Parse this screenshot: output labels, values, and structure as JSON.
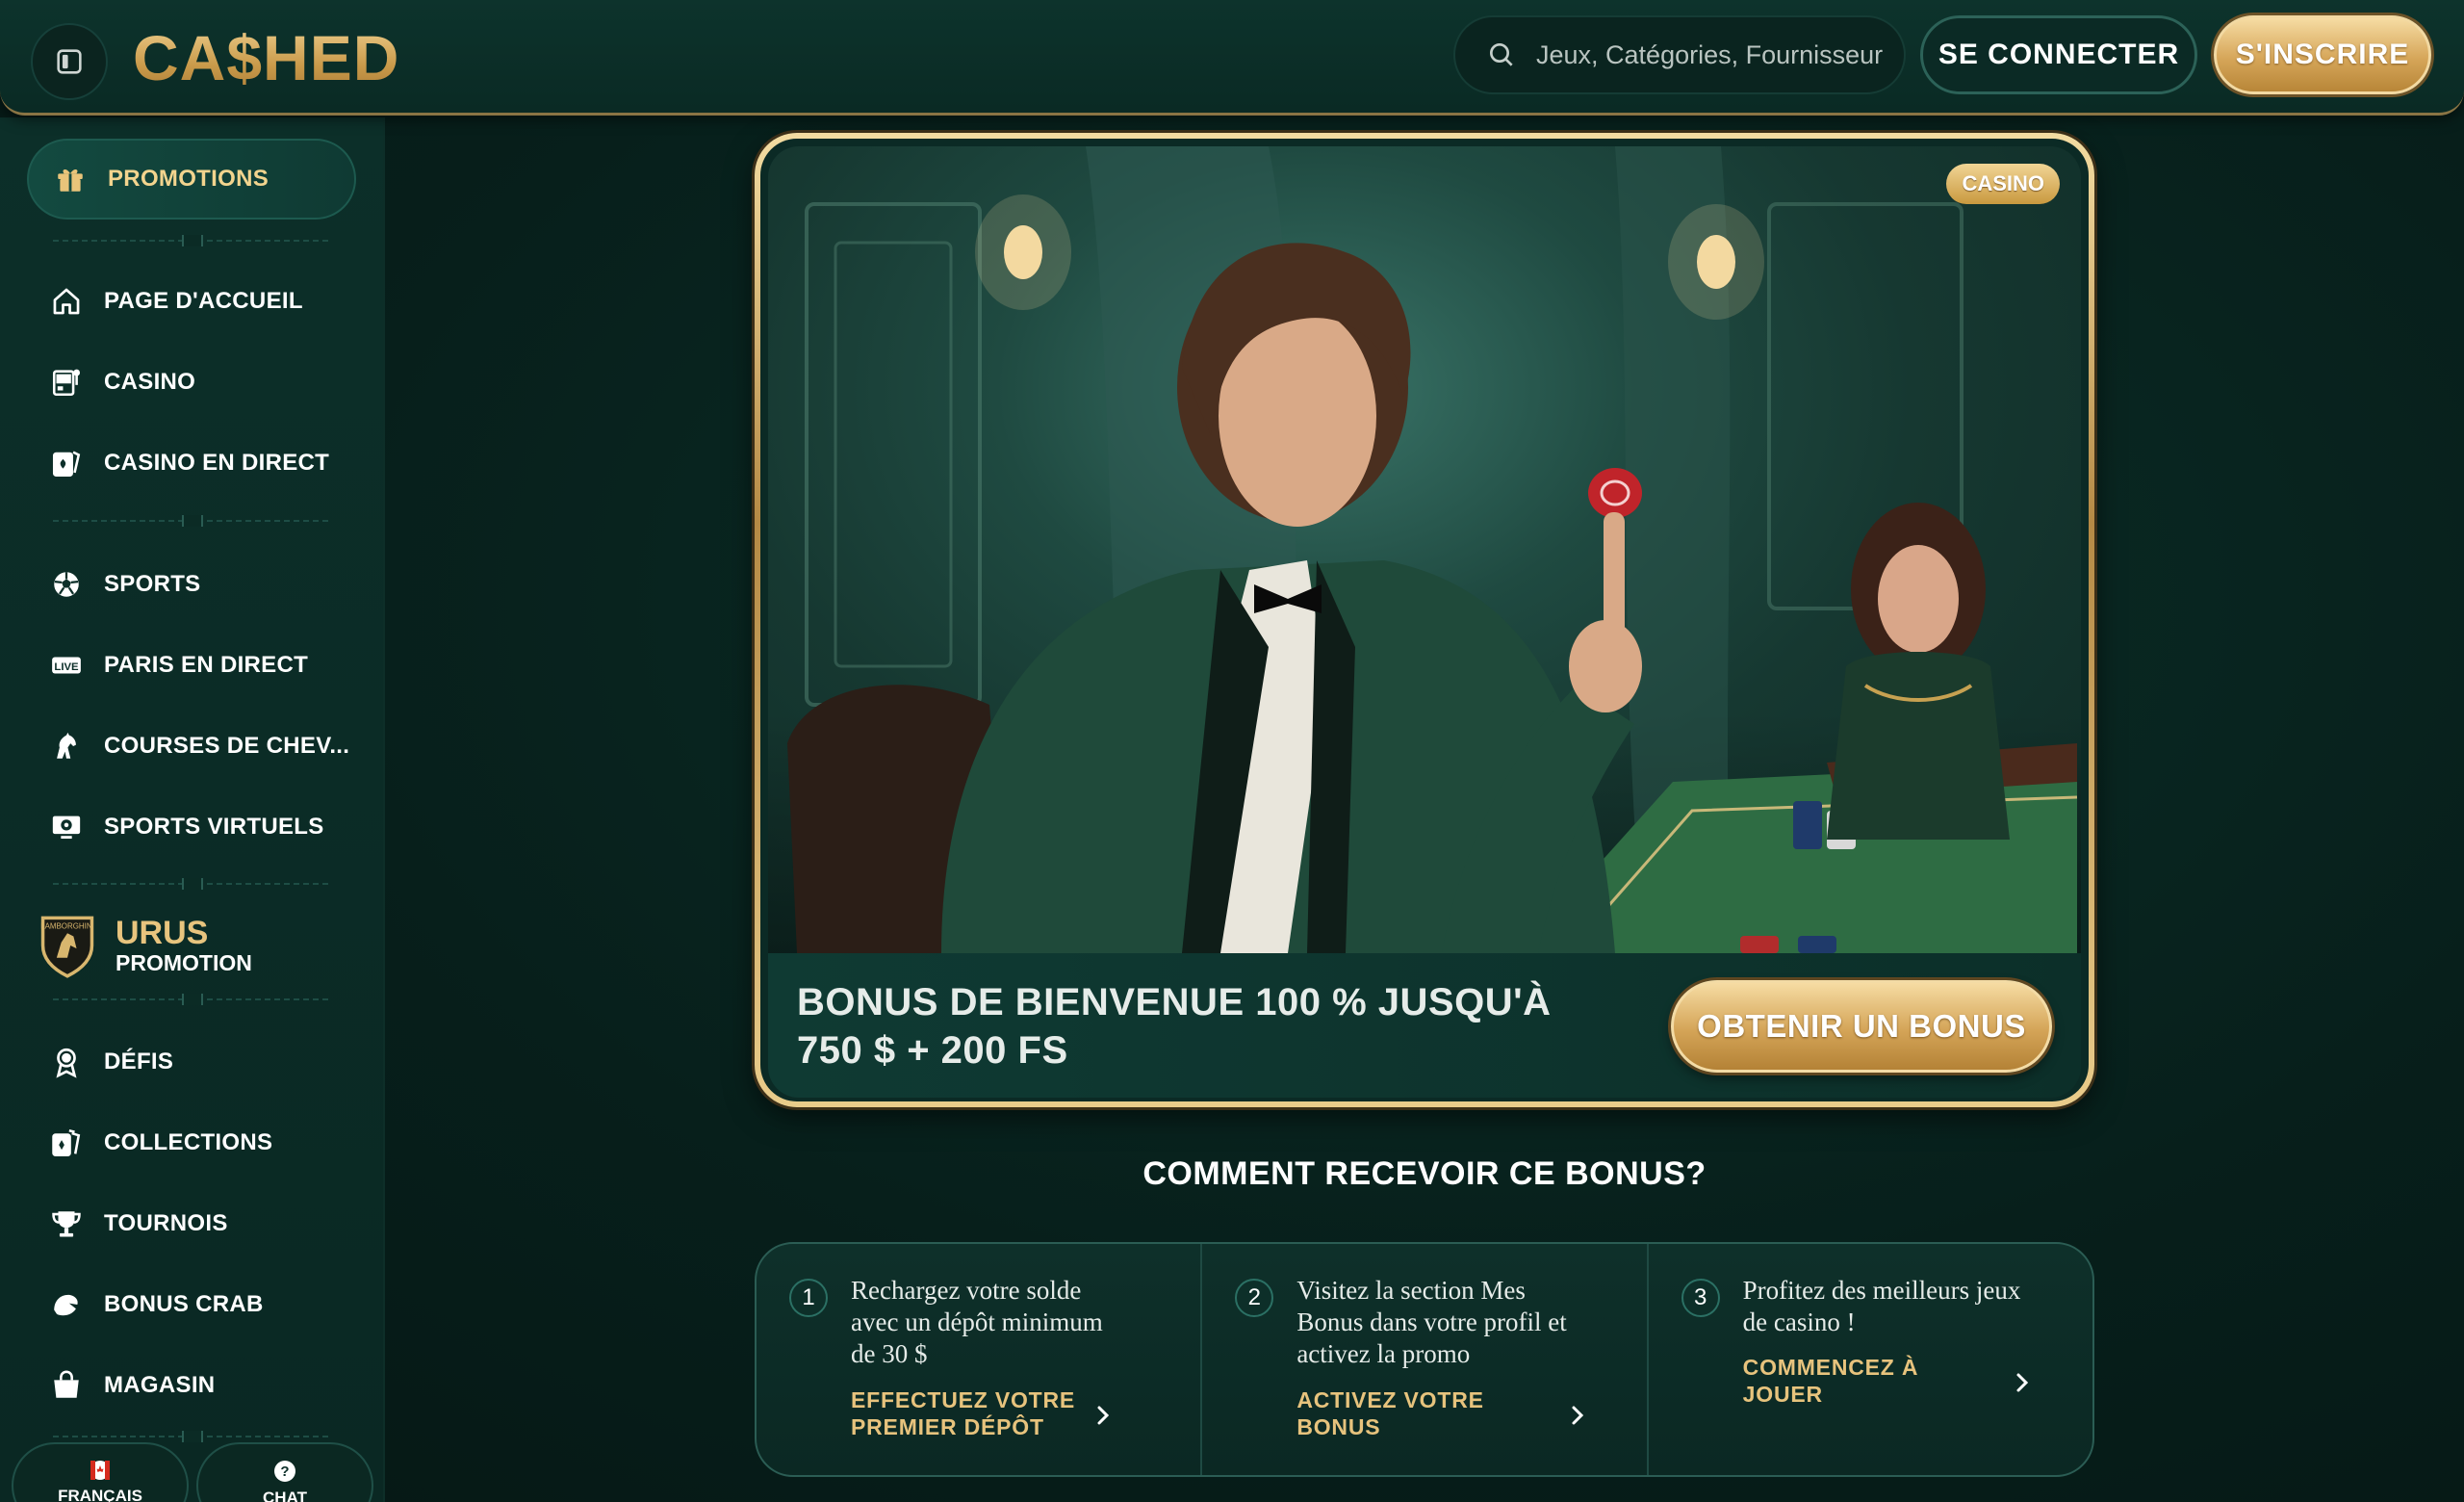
{
  "header": {
    "logo_text": "CA$HED",
    "search_placeholder": "Jeux, Catégories, Fournisseurs",
    "login_label": "SE CONNECTER",
    "register_label": "S'INSCRIRE"
  },
  "sidebar": {
    "promotions_label": "PROMOTIONS",
    "items_group1": [
      {
        "label": "PAGE D'ACCUEIL",
        "icon": "home-icon"
      },
      {
        "label": "CASINO",
        "icon": "slot-machine-icon"
      },
      {
        "label": "CASINO EN DIRECT",
        "icon": "live-cards-icon"
      }
    ],
    "items_group2": [
      {
        "label": "SPORTS",
        "icon": "soccer-ball-icon"
      },
      {
        "label": "PARIS EN DIRECT",
        "icon": "live-badge-icon"
      },
      {
        "label": "COURSES DE CHEV...",
        "icon": "horse-icon"
      },
      {
        "label": "SPORTS VIRTUELS",
        "icon": "virtual-sports-icon"
      }
    ],
    "urus": {
      "title": "URUS",
      "subtitle": "PROMOTION"
    },
    "items_group3": [
      {
        "label": "DÉFIS",
        "icon": "award-icon"
      },
      {
        "label": "COLLECTIONS",
        "icon": "cards-collection-icon"
      },
      {
        "label": "TOURNOIS",
        "icon": "trophy-icon"
      },
      {
        "label": "BONUS CRAB",
        "icon": "crab-claw-icon"
      },
      {
        "label": "MAGASIN",
        "icon": "shopping-bag-icon"
      }
    ],
    "language_label": "FRANÇAIS",
    "chat_label": "CHAT"
  },
  "banner": {
    "badge": "CASINO",
    "title_line1": "BONUS DE BIENVENUE 100 % JUSQU'À",
    "title_line2": "750 $ + 200 FS",
    "cta_label": "OBTENIR UN BONUS"
  },
  "howto": {
    "title": "COMMENT RECEVOIR CE BONUS?",
    "steps": [
      {
        "number": "1",
        "text": "Rechargez votre solde avec un dépôt minimum de 30 $",
        "link": "EFFECTUEZ VOTRE PREMIER DÉPÔT"
      },
      {
        "number": "2",
        "text": "Visitez la section Mes Bonus dans votre profil et activez la promo",
        "link": "ACTIVEZ VOTRE BONUS"
      },
      {
        "number": "3",
        "text": "Profitez des meilleurs jeux de casino !",
        "link": "COMMENCEZ À JOUER"
      }
    ]
  },
  "colors": {
    "gold": "#e7c37d",
    "background": "#071f1b",
    "panel": "#0c2f29"
  }
}
